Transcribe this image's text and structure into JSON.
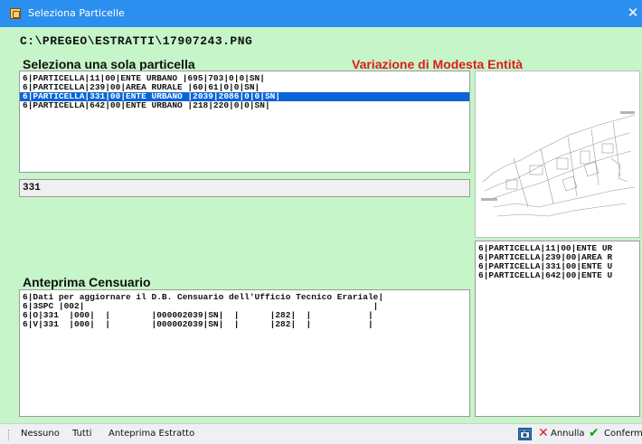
{
  "window": {
    "title": "Seleziona Particelle",
    "close_glyph": "✕"
  },
  "path": "C:\\PREGEO\\ESTRATTI\\17907243.PNG",
  "selection": {
    "heading": "Seleziona una sola particella",
    "right_heading": "Variazione di Modesta Entità",
    "rows": [
      "6|PARTICELLA|11|00|ENTE URBANO |695|703|0|0|SN|",
      "6|PARTICELLA|239|00|AREA RURALE |60|61|0|0|SN|",
      "6|PARTICELLA|331|00|ENTE URBANO |2039|2086|0|0|SN|",
      "6|PARTICELLA|642|00|ENTE URBANO |218|220|0|0|SN|"
    ],
    "selected_index": 2,
    "code_value": "331"
  },
  "side_list": {
    "rows": [
      "6|PARTICELLA|11|00|ENTE UR",
      "6|PARTICELLA|239|00|AREA R",
      "6|PARTICELLA|331|00|ENTE U",
      "6|PARTICELLA|642|00|ENTE U"
    ]
  },
  "census": {
    "heading": "Anteprima Censuario",
    "rows": [
      "6|Dati per aggiornare il D.B. Censuario dell'Ufficio Tecnico Erariale|",
      "6|3SPC |002|                                                        |",
      "6|O|331  |000|  |        |000002039|SN|  |      |282|  |           |",
      "6|V|331  |000|  |        |000002039|SN|  |      |282|  |           |"
    ]
  },
  "statusbar": {
    "nessuno": "Nessuno",
    "tutti": "Tutti",
    "anteprima": "Anteprima Estratto",
    "annulla": "Annulla",
    "conferma": "Conferma"
  },
  "icons": {
    "app": "app-icon",
    "camera": "camera-icon",
    "cancel": "x-icon",
    "confirm": "checkmark-icon"
  },
  "colors": {
    "titlebar": "#2b8ff0",
    "client_bg": "#c5f5c8",
    "selection": "#0a64d8",
    "accent_red": "#e01b1b",
    "confirm_green": "#1a9a1a"
  }
}
